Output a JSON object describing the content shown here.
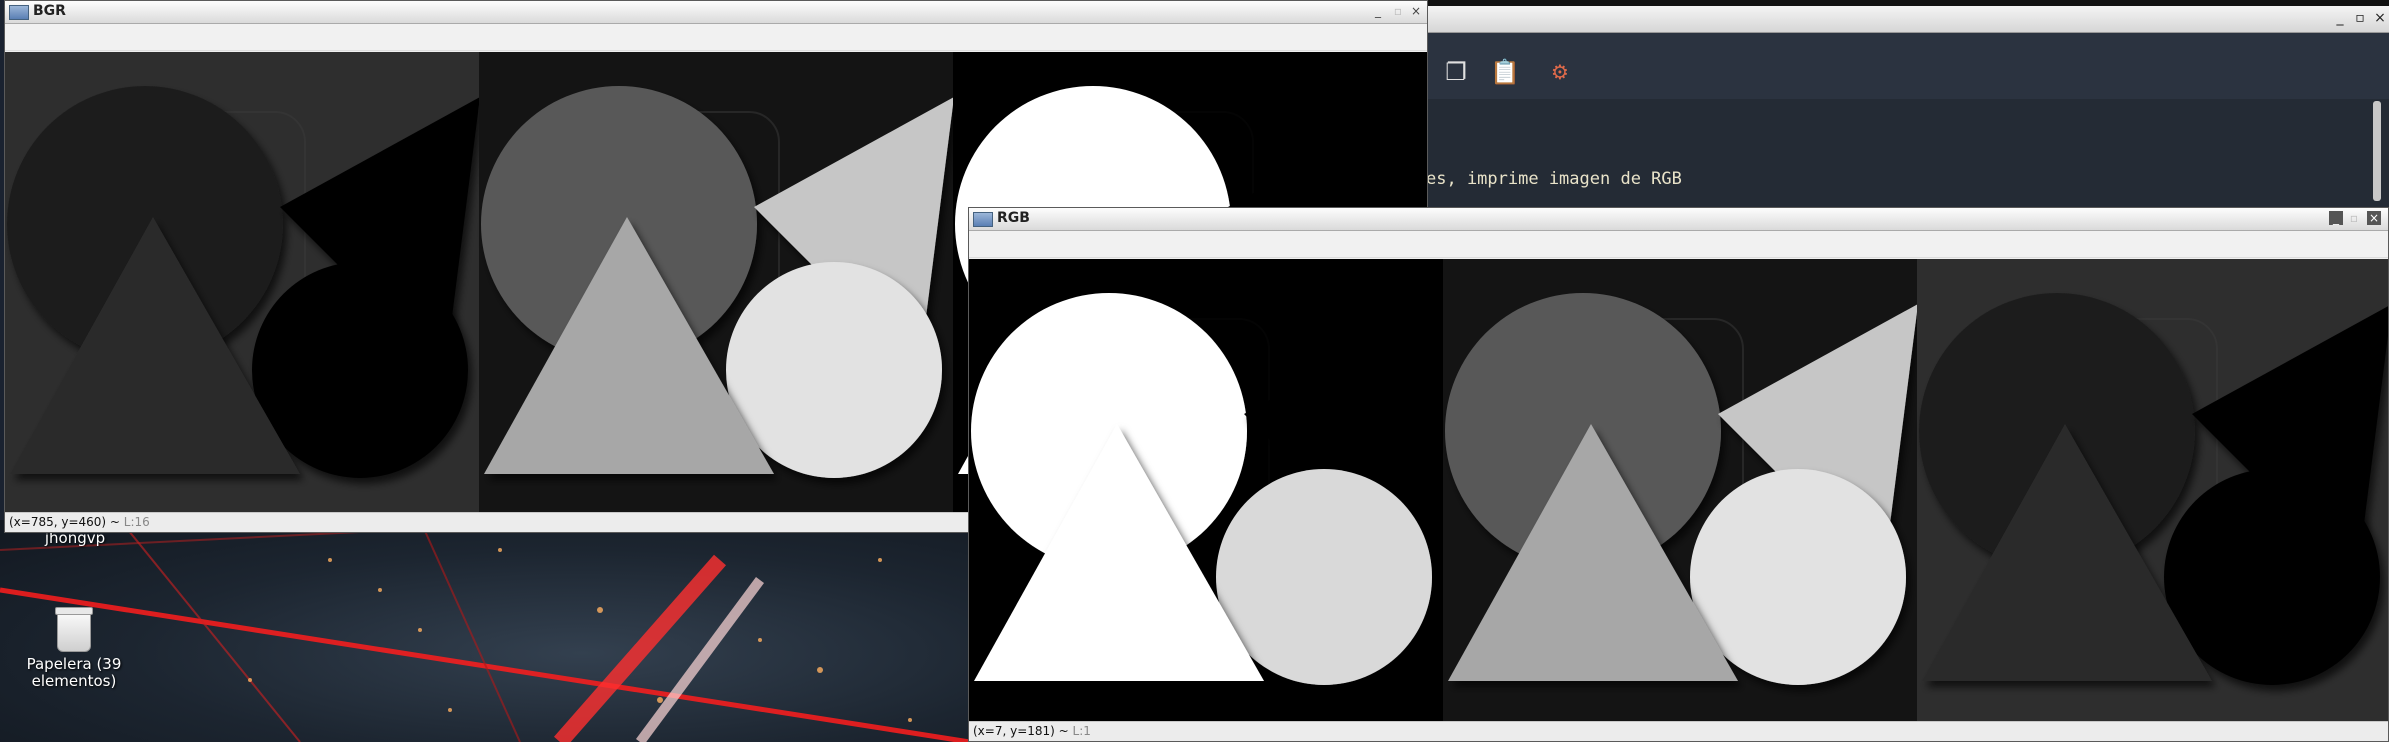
{
  "desktop": {
    "icons": [
      {
        "label": "jhongvp"
      },
      {
        "label": "Papelera (39 elementos)"
      }
    ]
  },
  "editor": {
    "code_line": "es, imprime imagen de RGB",
    "toolbar_icons": [
      "copy-icon",
      "paste-icon",
      "tools-icon"
    ],
    "controls": [
      "_",
      "▫",
      "×"
    ]
  },
  "bgr_window": {
    "title": "BGR",
    "status_coords": "(x=785, y=460) ~ ",
    "status_level": "L:16",
    "panels": [
      {
        "bg": "#2e2e2e",
        "circle1": "#1f1f1f",
        "triangle_dark": "#050505",
        "circle2": "#030303",
        "triangle_front": "#2c2c2c"
      },
      {
        "bg": "#141414",
        "circle1": "#595959",
        "triangle_dark": "#c6c6c6",
        "circle2": "#e2e2e2",
        "triangle_front": "#a7a7a7"
      },
      {
        "bg": "#000000",
        "circle1": "#ffffff",
        "triangle_dark": "#040404",
        "circle2": "#d9d9d9",
        "triangle_front": "#ffffff"
      }
    ]
  },
  "rgb_window": {
    "title": "RGB",
    "status_coords": "(x=7, y=181) ~ ",
    "status_level": "L:1",
    "panels": [
      {
        "bg": "#000000",
        "circle1": "#ffffff",
        "triangle_dark": "#040404",
        "circle2": "#d9d9d9",
        "triangle_front": "#ffffff"
      },
      {
        "bg": "#141414",
        "circle1": "#595959",
        "triangle_dark": "#c6c6c6",
        "circle2": "#e2e2e2",
        "triangle_front": "#a7a7a7"
      },
      {
        "bg": "#2e2e2e",
        "circle1": "#1f1f1f",
        "triangle_dark": "#050505",
        "circle2": "#030303",
        "triangle_front": "#2c2c2c"
      }
    ]
  }
}
